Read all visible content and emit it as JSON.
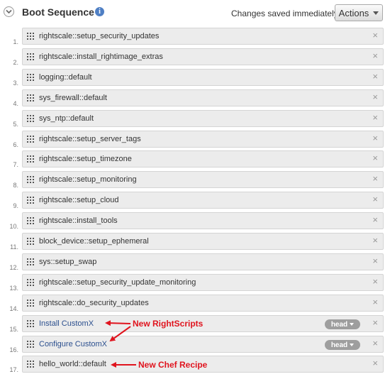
{
  "header": {
    "title": "Boot Sequence",
    "info_glyph": "i",
    "status": "Changes saved immediately",
    "actions_label": "Actions"
  },
  "items": [
    {
      "number": "1.",
      "label": "rightscale::setup_security_updates"
    },
    {
      "number": "2.",
      "label": "rightscale::install_rightimage_extras"
    },
    {
      "number": "3.",
      "label": "logging::default"
    },
    {
      "number": "4.",
      "label": "sys_firewall::default"
    },
    {
      "number": "5.",
      "label": "sys_ntp::default"
    },
    {
      "number": "6.",
      "label": "rightscale::setup_server_tags"
    },
    {
      "number": "7.",
      "label": "rightscale::setup_timezone"
    },
    {
      "number": "8.",
      "label": "rightscale::setup_monitoring"
    },
    {
      "number": "9.",
      "label": "rightscale::setup_cloud"
    },
    {
      "number": "10.",
      "label": "rightscale::install_tools"
    },
    {
      "number": "11.",
      "label": "block_device::setup_ephemeral"
    },
    {
      "number": "12.",
      "label": "sys::setup_swap"
    },
    {
      "number": "13.",
      "label": "rightscale::setup_security_update_monitoring"
    },
    {
      "number": "14.",
      "label": "rightscale::do_security_updates"
    },
    {
      "number": "15.",
      "label": "Install CustomX",
      "badge": "head"
    },
    {
      "number": "16.",
      "label": "Configure CustomX",
      "badge": "head"
    },
    {
      "number": "17.",
      "label": "hello_world::default"
    }
  ],
  "remove_glyph": "×",
  "annotations": {
    "rightscripts": "New RightScripts",
    "chef_recipe": "New Chef Recipe"
  },
  "colors": {
    "annotation": "#e0141e",
    "link": "#2b4f8e",
    "badge": "#9e9e9e",
    "row_bg": "#ececec"
  },
  "icons": {
    "collapse": "chevron-down-icon",
    "info": "info-icon",
    "drag": "drag-handle-icon",
    "remove": "close-icon"
  }
}
